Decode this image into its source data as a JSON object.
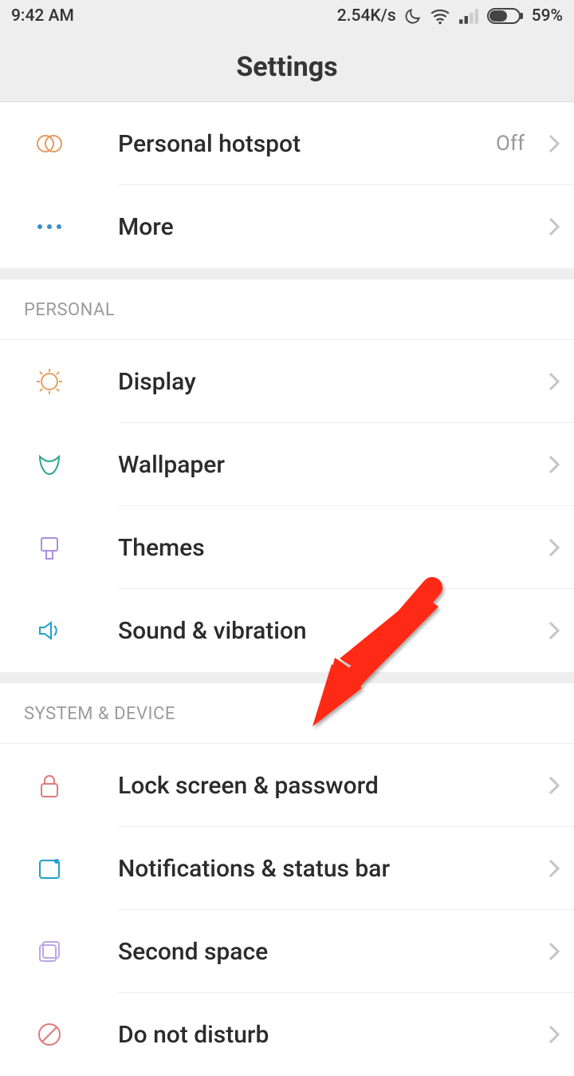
{
  "status_bar": {
    "time": "9:42 AM",
    "net_speed": "2.54K/s",
    "battery_pct": "59%"
  },
  "title": "Settings",
  "sections": [
    {
      "header": null,
      "items": [
        {
          "label": "Personal hotspot",
          "value": "Off",
          "icon": "hotspot"
        },
        {
          "label": "More",
          "value": null,
          "icon": "more"
        }
      ]
    },
    {
      "header": "PERSONAL",
      "items": [
        {
          "label": "Display",
          "icon": "display"
        },
        {
          "label": "Wallpaper",
          "icon": "wallpaper"
        },
        {
          "label": "Themes",
          "icon": "themes"
        },
        {
          "label": "Sound & vibration",
          "icon": "sound"
        }
      ]
    },
    {
      "header": "SYSTEM & DEVICE",
      "items": [
        {
          "label": "Lock screen & password",
          "icon": "lock"
        },
        {
          "label": "Notifications & status bar",
          "icon": "notifications"
        },
        {
          "label": "Second space",
          "icon": "secondspace"
        },
        {
          "label": "Do not disturb",
          "icon": "dnd"
        }
      ]
    }
  ]
}
